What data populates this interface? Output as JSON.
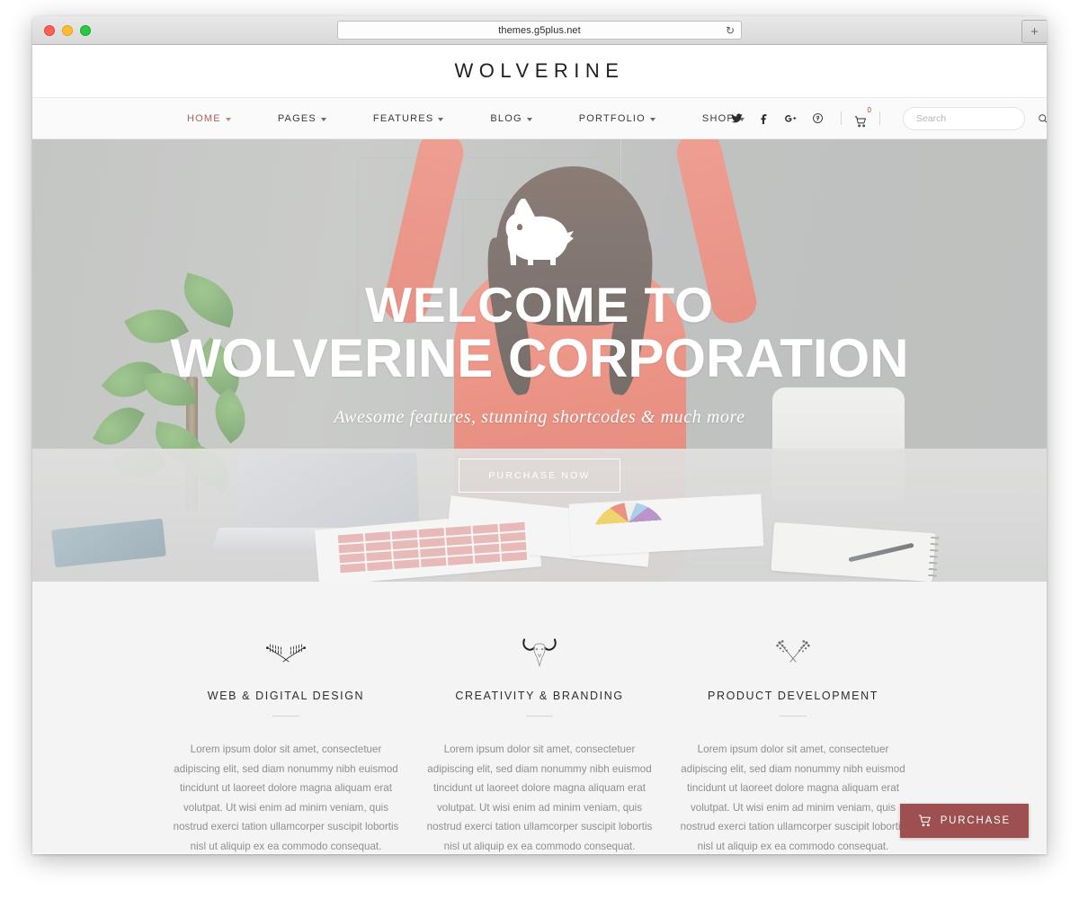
{
  "browser": {
    "url": "themes.g5plus.net",
    "reload_icon": "reload-icon",
    "new_tab_label": "+",
    "traffic_lights": [
      "close",
      "minimize",
      "maximize"
    ]
  },
  "site": {
    "logo": "WOLVERINE"
  },
  "nav": {
    "items": [
      {
        "label": "HOME",
        "has_dropdown": true,
        "active": true
      },
      {
        "label": "PAGES",
        "has_dropdown": true,
        "active": false
      },
      {
        "label": "FEATURES",
        "has_dropdown": true,
        "active": false
      },
      {
        "label": "BLOG",
        "has_dropdown": true,
        "active": false
      },
      {
        "label": "PORTFOLIO",
        "has_dropdown": true,
        "active": false
      },
      {
        "label": "SHOP",
        "has_dropdown": true,
        "active": false
      }
    ],
    "social": [
      {
        "name": "twitter-icon"
      },
      {
        "name": "facebook-icon"
      },
      {
        "name": "google-plus-icon"
      },
      {
        "name": "pinterest-icon"
      }
    ],
    "cart": {
      "count": "0",
      "icon": "shopping-cart-icon"
    },
    "search": {
      "placeholder": "Search",
      "value": "",
      "icon": "search-icon"
    },
    "active_color": "#b05f5f"
  },
  "hero": {
    "logo_icon": "wolf-howling-icon",
    "title_line1": "WELCOME TO",
    "title_line2": "WOLVERINE CORPORATION",
    "subtitle": "Awesome features, stunning shortcodes & much more",
    "button_label": "PURCHASE NOW"
  },
  "features": {
    "body_text": "Lorem ipsum dolor sit amet, consectetuer adipiscing elit, sed diam nonummy nibh euismod tincidunt ut laoreet dolore magna aliquam erat volutpat. Ut wisi enim ad minim veniam, quis nostrud exerci tation ullamcorper suscipit lobortis nisl ut aliquip ex ea commodo consequat.",
    "columns": [
      {
        "icon": "crossed-feathers-icon",
        "title": "WEB & DIGITAL DESIGN",
        "text": "Lorem ipsum dolor sit amet, consectetuer adipiscing elit, sed diam nonummy nibh euismod tincidunt ut laoreet dolore magna aliquam erat volutpat. Ut wisi enim ad minim veniam, quis nostrud exerci tation ullamcorper suscipit lobortis nisl ut aliquip ex ea commodo consequat."
      },
      {
        "icon": "bull-skull-icon",
        "title": "CREATIVITY & BRANDING",
        "text": "Lorem ipsum dolor sit amet, consectetuer adipiscing elit, sed diam nonummy nibh euismod tincidunt ut laoreet dolore magna aliquam erat volutpat. Ut wisi enim ad minim veniam, quis nostrud exerci tation ullamcorper suscipit lobortis nisl ut aliquip ex ea commodo consequat."
      },
      {
        "icon": "crossed-floral-sprigs-icon",
        "title": "PRODUCT DEVELOPMENT",
        "text": "Lorem ipsum dolor sit amet, consectetuer adipiscing elit, sed diam nonummy nibh euismod tincidunt ut laoreet dolore magna aliquam erat volutpat. Ut wisi enim ad minim veniam, quis nostrud exerci tation ullamcorper suscipit lobortis nisl ut aliquip ex ea commodo consequat."
      }
    ]
  },
  "purchase_button": {
    "label": "PURCHASE",
    "icon": "shopping-cart-icon",
    "color": "#9e4f4f"
  }
}
